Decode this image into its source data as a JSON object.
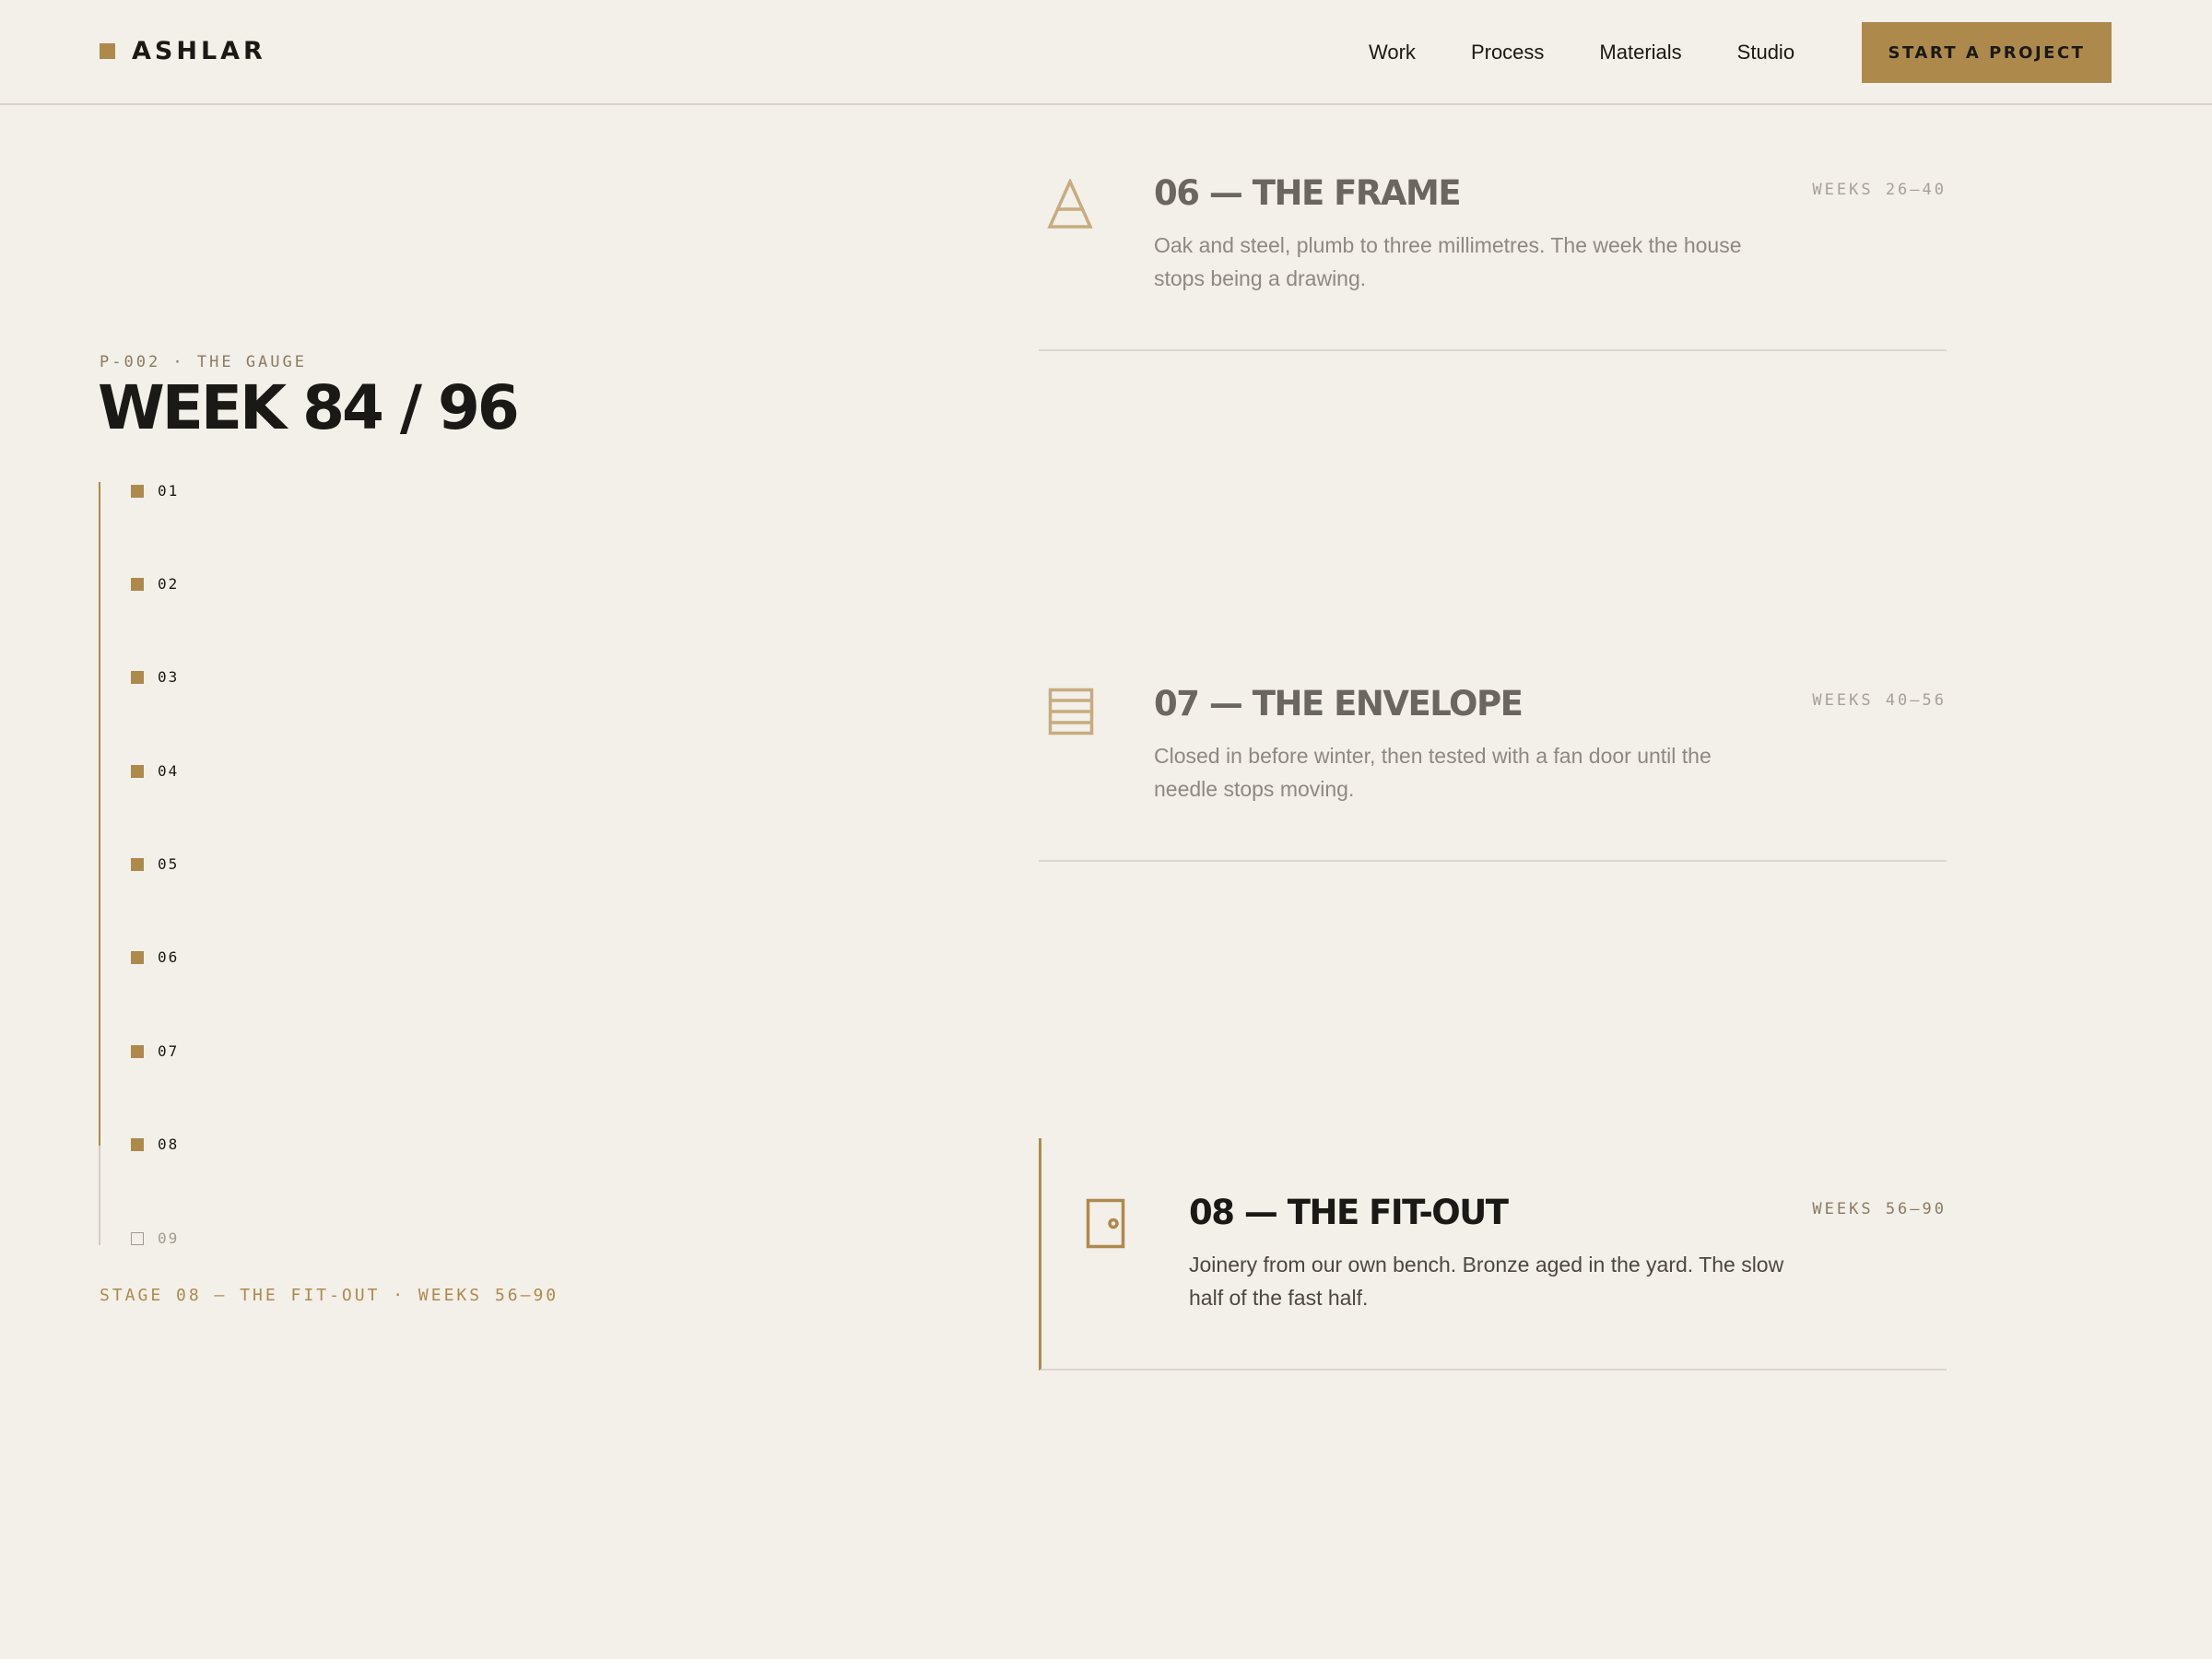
{
  "header": {
    "logo": "ASHLAR",
    "nav": [
      "Work",
      "Process",
      "Materials",
      "Studio"
    ],
    "cta": "START A PROJECT"
  },
  "gauge": {
    "eyebrow": "P-002 · THE GAUGE",
    "title": "WEEK 84 / 96",
    "ticks": [
      "01",
      "02",
      "03",
      "04",
      "05",
      "06",
      "07",
      "08",
      "09"
    ],
    "completed_count": 8,
    "stage_note": "STAGE 08 — THE FIT-OUT · WEEKS 56–90"
  },
  "stages": [
    {
      "title": "06 — THE FRAME",
      "desc": "Oak and steel, plumb to three millimetres. The week the house stops being a drawing.",
      "weeks": "WEEKS 26–40",
      "icon": "triangle-frame-icon"
    },
    {
      "title": "07 — THE ENVELOPE",
      "desc": "Closed in before winter, then tested with a fan door until the needle stops moving.",
      "weeks": "WEEKS 40–56",
      "icon": "wall-layers-icon"
    },
    {
      "title": "08 — THE FIT-OUT",
      "desc": "Joinery from our own bench. Bronze aged in the yard. The slow half of the fast half.",
      "weeks": "WEEKS 56–90",
      "icon": "door-icon"
    }
  ],
  "colors": {
    "background": "#f3efe9",
    "accent": "#ad8a4c",
    "ink": "#1b1915",
    "rule": "#dcd7cf"
  }
}
